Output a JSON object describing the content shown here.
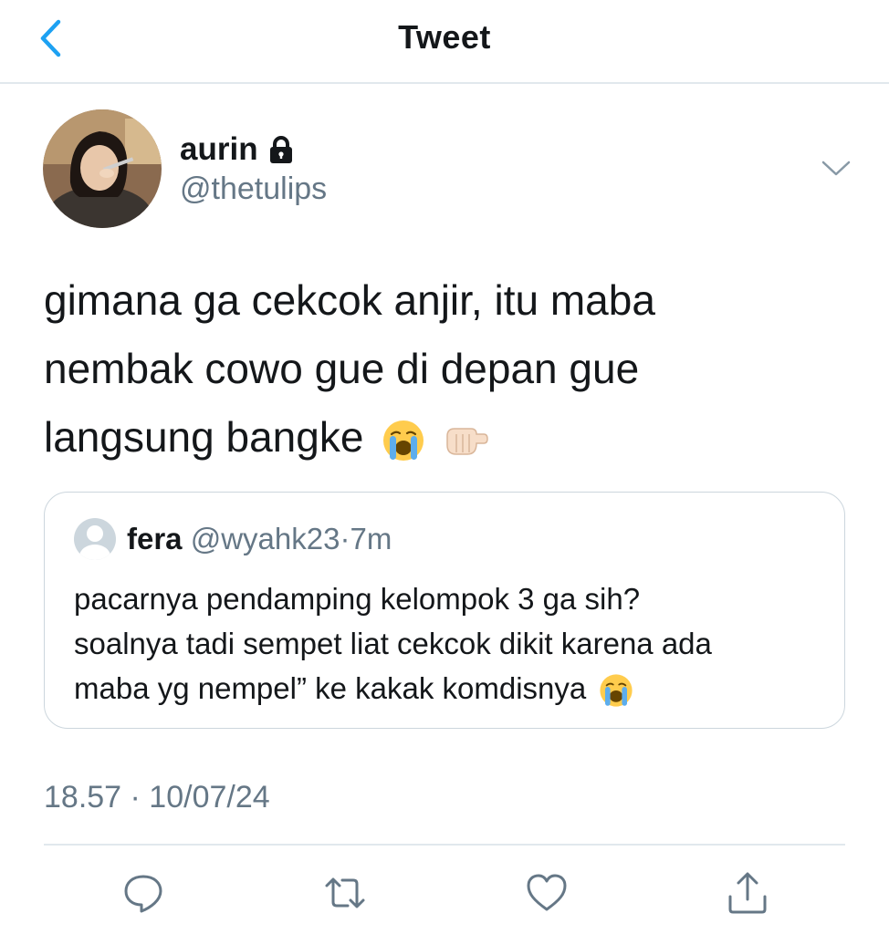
{
  "header": {
    "title": "Tweet"
  },
  "author": {
    "display_name": "aurin",
    "handle": "@thetulips"
  },
  "tweet": {
    "lines": [
      "gimana ga cekcok anjir, itu maba",
      "nembak cowo gue di depan gue",
      "langsung bangke"
    ],
    "emojis": [
      "loudly-crying-face",
      "backhand-pointing-fist"
    ]
  },
  "quoted": {
    "name": "fera",
    "handle": "@wyahk23",
    "separator": "·",
    "time": "7m",
    "lines": [
      "pacarnya pendamping kelompok 3 ga sih?",
      "soalnya tadi sempet liat cekcok dikit karena ada",
      "maba yg nempel” ke kakak komdisnya"
    ],
    "emoji": "loudly-crying-face"
  },
  "timestamp": "18.57 · 10/07/24",
  "colors": {
    "accent": "#1da1f2",
    "text": "#14171a",
    "secondary": "#657786",
    "border": "#ccd6dd"
  },
  "icons": {
    "back": "chevron-left-icon",
    "lock": "lock-icon",
    "more": "chevron-down-icon",
    "reply": "reply-icon",
    "retweet": "retweet-icon",
    "like": "heart-icon",
    "share": "share-icon"
  }
}
